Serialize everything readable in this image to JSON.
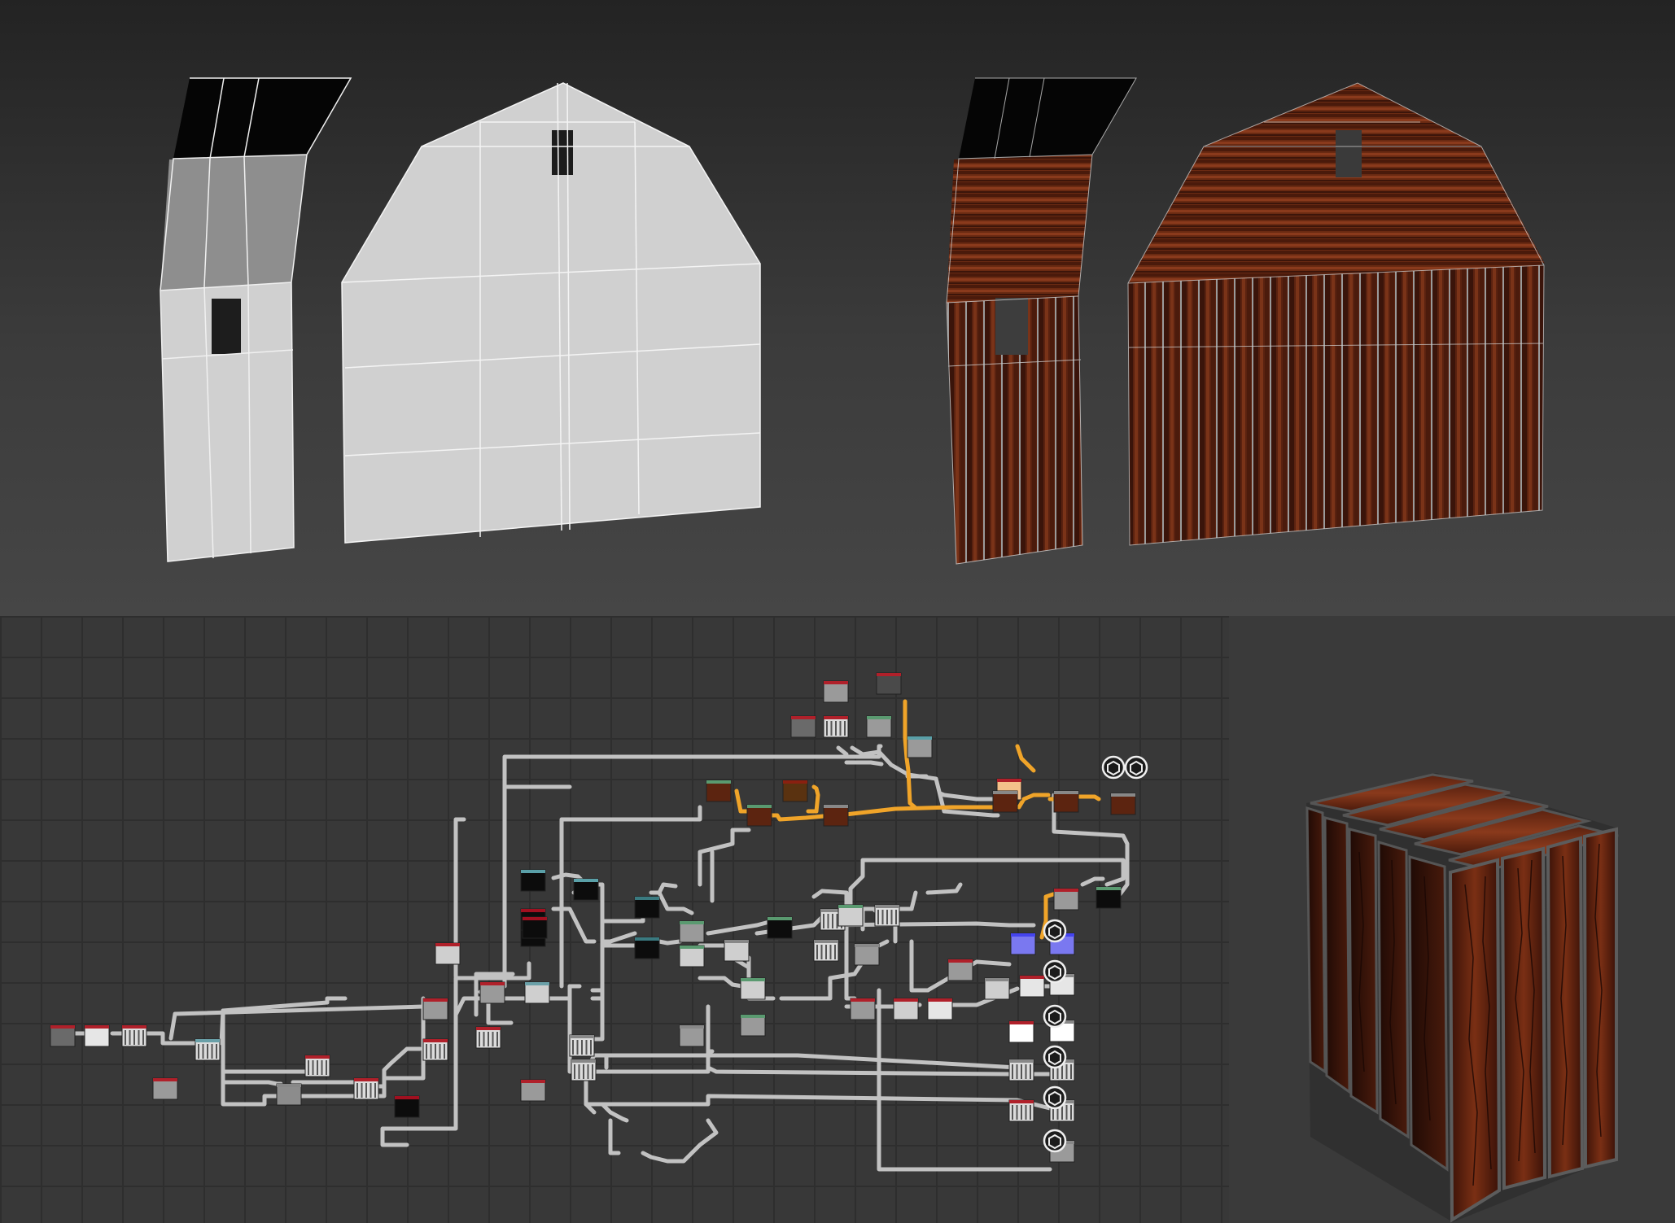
{
  "panels": {
    "viewport": "3d-viewport",
    "graph": "node-graph",
    "preview": "material-preview"
  },
  "colors": {
    "viewport_bg_top": "#232323",
    "viewport_bg_bottom": "#464646",
    "graph_bg": "#383838",
    "grid_line": "#2e2e2e",
    "wire": "#c4c4c4",
    "wire_active": "#f0a429",
    "wood_dark": "#3c160b",
    "wood_light": "#8a3a1c",
    "mesh_gray": "#cfcfcf"
  },
  "icons": [
    "output-node-icon",
    "checker-node-icon"
  ]
}
